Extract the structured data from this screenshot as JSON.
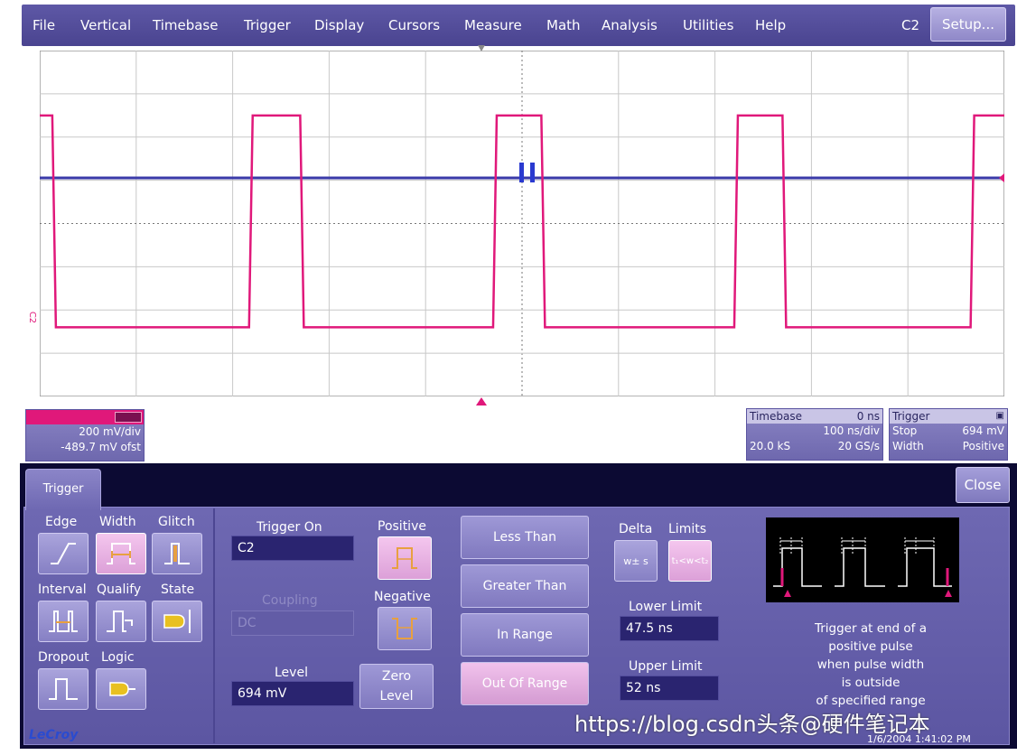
{
  "menu": {
    "items": [
      "File",
      "Vertical",
      "Timebase",
      "Trigger",
      "Display",
      "Cursors",
      "Measure",
      "Math",
      "Analysis",
      "Utilities",
      "Help"
    ],
    "channel_tag": "C2",
    "setup_label": "Setup..."
  },
  "grid": {
    "channel_marker": "C2",
    "trace_color": "#e0187a",
    "trigger_line_color": "#3a3aa8",
    "waveform": {
      "low_level_div": -2.4,
      "high_level_div": 2.5,
      "initial_state": "high",
      "edges_div": [
        0.13,
        2.17,
        2.7,
        4.7,
        5.2,
        7.2,
        7.7,
        9.65
      ]
    }
  },
  "channel_box": {
    "value_volts_div": "200 mV/div",
    "value_offset": "-489.7 mV ofst"
  },
  "timebase_box": {
    "title": "Timebase",
    "delay": "0 ns",
    "time_div": "100 ns/div",
    "samples": "20.0 kS",
    "rate": "20 GS/s"
  },
  "trigger_box": {
    "title": "Trigger",
    "mode_label": "Stop",
    "level": "694 mV",
    "type_label": "Width",
    "polarity": "Positive"
  },
  "dialog": {
    "tab_label": "Trigger",
    "close_label": "Close",
    "types": [
      {
        "label": "Edge"
      },
      {
        "label": "Width"
      },
      {
        "label": "Glitch"
      },
      {
        "label": "Interval"
      },
      {
        "label": "Qualify"
      },
      {
        "label": "State"
      },
      {
        "label": "Dropout"
      },
      {
        "label": "Logic"
      }
    ],
    "trigger_on_label": "Trigger On",
    "trigger_on_value": "C2",
    "coupling_label": "Coupling",
    "coupling_value": "DC",
    "level_label": "Level",
    "level_value": "694 mV",
    "zero_level_line1": "Zero",
    "zero_level_line2": "Level",
    "positive_label": "Positive",
    "negative_label": "Negative",
    "conditions": [
      "Less Than",
      "Greater Than",
      "In Range",
      "Out Of Range"
    ],
    "delta_label": "Delta",
    "delta_icon_text": "w± s",
    "limits_label": "Limits",
    "limits_icon_text": "t₁<w<t₂",
    "lower_limit_label": "Lower Limit",
    "lower_limit_value": "47.5 ns",
    "upper_limit_label": "Upper Limit",
    "upper_limit_value": "52 ns",
    "description_lines": [
      "Trigger at end of a",
      "positive pulse",
      "when pulse width",
      "is outside",
      "of specified range"
    ]
  },
  "footer": {
    "brand": "LeCroy",
    "date": "1/6/2004 1:41:02 PM"
  },
  "watermark": "https://blog.csdn头条@硬件笔记本"
}
